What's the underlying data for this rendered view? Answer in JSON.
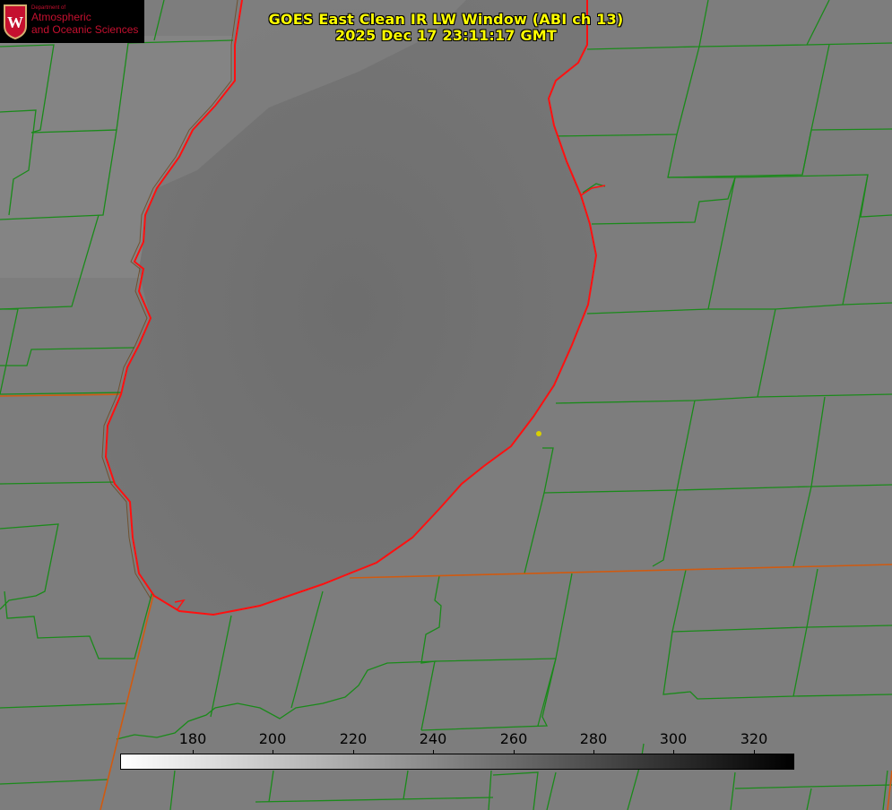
{
  "title": {
    "line1": "GOES East Clean IR LW Window (ABI ch 13)",
    "line2": "2025 Dec 17 23:11:17 GMT"
  },
  "logo": {
    "seal_icon": "uw-crest-icon",
    "dept_label": "Department of",
    "line1": "Atmospheric",
    "line2": "and Oceanic Sciences",
    "text_color": "#c5102f"
  },
  "colorbar": {
    "ticks": [
      "180",
      "200",
      "220",
      "240",
      "260",
      "280",
      "300",
      "320"
    ],
    "gradient": [
      "#ffffff",
      "#000000"
    ]
  },
  "colors": {
    "county_lines": "#1a8a1a",
    "coastline": "#ff0000",
    "marker": "#d8d000"
  }
}
